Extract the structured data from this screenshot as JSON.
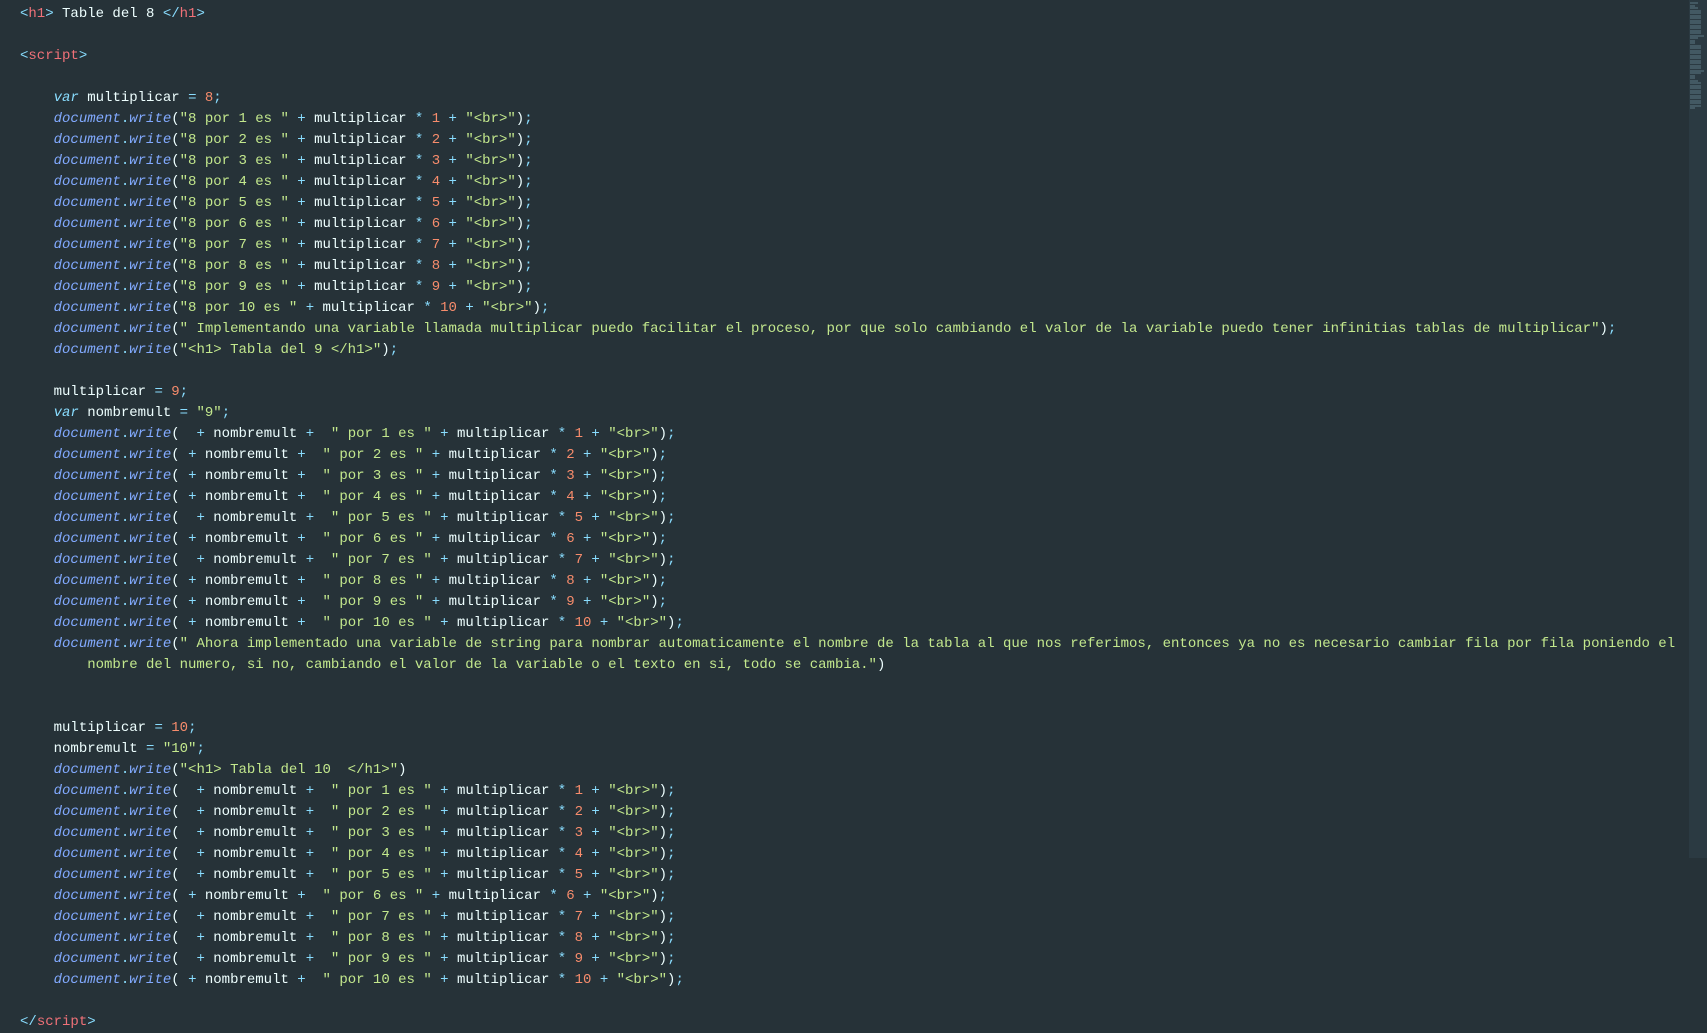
{
  "code": {
    "h1_text": " Table del 8 ",
    "var_decl": "multiplicar",
    "var_val": "8",
    "block1": [
      {
        "n": "1"
      },
      {
        "n": "2"
      },
      {
        "n": "3"
      },
      {
        "n": "4"
      },
      {
        "n": "5"
      },
      {
        "n": "6"
      },
      {
        "n": "7"
      },
      {
        "n": "8"
      },
      {
        "n": "9"
      },
      {
        "n": "10"
      }
    ],
    "block1_prefix": "\"8 por ",
    "block1_mid": " es \"",
    "br_str": "\"<br>\"",
    "comment1": "\" Implementando una variable llamada multiplicar puedo facilitar el proceso, por que solo cambiando el valor de la variable puedo tener infinitias tablas de multiplicar\"",
    "h1_tabla9": "\"<h1> Tabla del 9 </h1>\"",
    "mult9_assign": "9",
    "nombremult_decl": "nombremult",
    "nombremult_val": "\"9\"",
    "block2": [
      {
        "n": "1",
        "sp": "  "
      },
      {
        "n": "2",
        "sp": " "
      },
      {
        "n": "3",
        "sp": " "
      },
      {
        "n": "4",
        "sp": " "
      },
      {
        "n": "5",
        "sp": "  "
      },
      {
        "n": "6",
        "sp": " "
      },
      {
        "n": "7",
        "sp": "  "
      },
      {
        "n": "8",
        "sp": " "
      },
      {
        "n": "9",
        "sp": " "
      },
      {
        "n": "10",
        "sp": " "
      }
    ],
    "por_prefix": "\" por ",
    "es_suffix": " es \"",
    "comment2a": "\" Ahora implementado una variable de string para nombrar automaticamente el nombre de la tabla al que nos referimos, entonces ya no es necesario cambiar fila por fila poniendo el",
    "comment2b": "nombre del numero, si no, cambiando el valor de la variable o el texto en si, todo se cambia.\"",
    "mult10_assign": "10",
    "nombremult10_val": "\"10\"",
    "h1_tabla10": "\"<h1> Tabla del 10  </h1>\"",
    "block3": [
      {
        "n": "1",
        "sp": "  "
      },
      {
        "n": "2",
        "sp": "  "
      },
      {
        "n": "3",
        "sp": "  "
      },
      {
        "n": "4",
        "sp": "  "
      },
      {
        "n": "5",
        "sp": "  "
      },
      {
        "n": "6",
        "sp": " "
      },
      {
        "n": "7",
        "sp": "  "
      },
      {
        "n": "8",
        "sp": "  "
      },
      {
        "n": "9",
        "sp": "  "
      },
      {
        "n": "10",
        "sp": " "
      }
    ]
  },
  "tokens": {
    "document": "document",
    "write": "write",
    "var": "var",
    "multiplicar": "multiplicar",
    "nombremult": "nombremult",
    "h1": "h1",
    "script": "script"
  }
}
